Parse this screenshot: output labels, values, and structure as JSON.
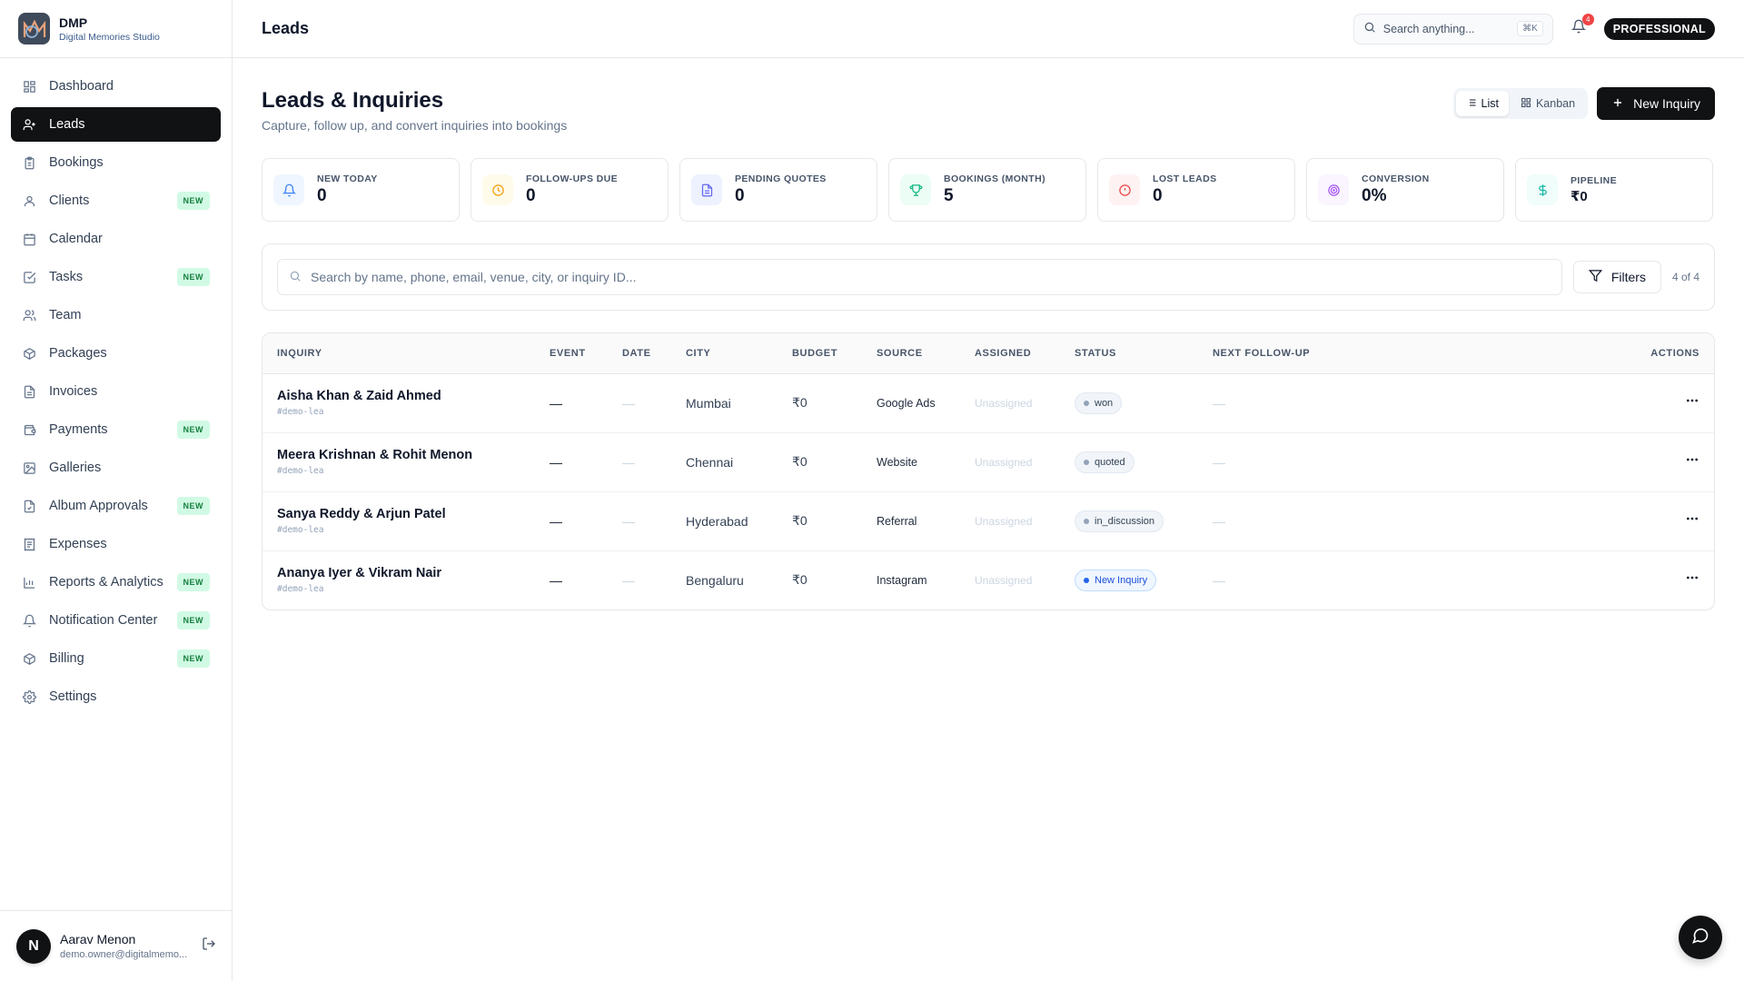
{
  "brand": {
    "name": "DMP",
    "subtitle": "Digital Memories Studio"
  },
  "sidebar": {
    "items": [
      {
        "label": "Dashboard",
        "icon": "dashboard-icon",
        "new": false,
        "active": false
      },
      {
        "label": "Leads",
        "icon": "user-plus-icon",
        "new": false,
        "active": true
      },
      {
        "label": "Bookings",
        "icon": "clipboard-icon",
        "new": false,
        "active": false
      },
      {
        "label": "Clients",
        "icon": "user-icon",
        "new": true,
        "active": false
      },
      {
        "label": "Calendar",
        "icon": "calendar-icon",
        "new": false,
        "active": false
      },
      {
        "label": "Tasks",
        "icon": "checkbox-icon",
        "new": true,
        "active": false
      },
      {
        "label": "Team",
        "icon": "users-icon",
        "new": false,
        "active": false
      },
      {
        "label": "Packages",
        "icon": "package-icon",
        "new": false,
        "active": false
      },
      {
        "label": "Invoices",
        "icon": "file-icon",
        "new": false,
        "active": false
      },
      {
        "label": "Payments",
        "icon": "wallet-icon",
        "new": true,
        "active": false
      },
      {
        "label": "Galleries",
        "icon": "image-icon",
        "new": false,
        "active": false
      },
      {
        "label": "Album Approvals",
        "icon": "file-check-icon",
        "new": true,
        "active": false
      },
      {
        "label": "Expenses",
        "icon": "receipt-icon",
        "new": false,
        "active": false
      },
      {
        "label": "Reports & Analytics",
        "icon": "bar-chart-icon",
        "new": true,
        "active": false
      },
      {
        "label": "Notification Center",
        "icon": "bell-icon",
        "new": true,
        "active": false
      },
      {
        "label": "Billing",
        "icon": "billing-icon",
        "new": true,
        "active": false
      },
      {
        "label": "Settings",
        "icon": "gear-icon",
        "new": false,
        "active": false
      }
    ],
    "new_badge": "NEW"
  },
  "user": {
    "initial": "N",
    "name": "Aarav Menon",
    "email": "demo.owner@digitalmemo..."
  },
  "topbar": {
    "title": "Leads",
    "search_placeholder": "Search anything...",
    "shortcut": "⌘K",
    "notification_count": "4",
    "plan": "PROFESSIONAL"
  },
  "page": {
    "title": "Leads & Inquiries",
    "subtitle": "Capture, follow up, and convert inquiries into bookings",
    "view_list": "List",
    "view_kanban": "Kanban",
    "new_button": "New Inquiry"
  },
  "stats": [
    {
      "label": "NEW TODAY",
      "value": "0",
      "icon": "bell-icon",
      "bg": "#eff6ff",
      "color": "#3b82f6"
    },
    {
      "label": "FOLLOW-UPS DUE",
      "value": "0",
      "icon": "clock-icon",
      "bg": "#fffbeb",
      "color": "#f59e0b"
    },
    {
      "label": "PENDING QUOTES",
      "value": "0",
      "icon": "document-icon",
      "bg": "#eef2ff",
      "color": "#6366f1"
    },
    {
      "label": "BOOKINGS (MONTH)",
      "value": "5",
      "icon": "trophy-icon",
      "bg": "#ecfdf5",
      "color": "#10b981"
    },
    {
      "label": "LOST LEADS",
      "value": "0",
      "icon": "alert-icon",
      "bg": "#fef2f2",
      "color": "#ef4444"
    },
    {
      "label": "CONVERSION",
      "value": "0%",
      "icon": "target-icon",
      "bg": "#faf5ff",
      "color": "#a855f7"
    },
    {
      "label": "PIPELINE",
      "value": "₹0",
      "icon": "dollar-icon",
      "bg": "#f0fdfa",
      "color": "#14b8a6"
    }
  ],
  "search": {
    "placeholder": "Search by name, phone, email, venue, city, or inquiry ID...",
    "filters_label": "Filters",
    "count": "4 of 4"
  },
  "table": {
    "headers": [
      "INQUIRY",
      "EVENT",
      "DATE",
      "CITY",
      "BUDGET",
      "SOURCE",
      "ASSIGNED",
      "STATUS",
      "NEXT FOLLOW-UP",
      "ACTIONS"
    ],
    "rows": [
      {
        "name": "Aisha Khan & Zaid Ahmed",
        "id": "#demo-lea",
        "event": "—",
        "date": "—",
        "city": "Mumbai",
        "budget": "₹0",
        "source": "Google Ads",
        "assigned": "Unassigned",
        "status": "won",
        "status_style": "gray",
        "next": "—"
      },
      {
        "name": "Meera Krishnan & Rohit Menon",
        "id": "#demo-lea",
        "event": "—",
        "date": "—",
        "city": "Chennai",
        "budget": "₹0",
        "source": "Website",
        "assigned": "Unassigned",
        "status": "quoted",
        "status_style": "gray",
        "next": "—"
      },
      {
        "name": "Sanya Reddy & Arjun Patel",
        "id": "#demo-lea",
        "event": "—",
        "date": "—",
        "city": "Hyderabad",
        "budget": "₹0",
        "source": "Referral",
        "assigned": "Unassigned",
        "status": "in_discussion",
        "status_style": "gray",
        "next": "—"
      },
      {
        "name": "Ananya Iyer & Vikram Nair",
        "id": "#demo-lea",
        "event": "—",
        "date": "—",
        "city": "Bengaluru",
        "budget": "₹0",
        "source": "Instagram",
        "assigned": "Unassigned",
        "status": "New Inquiry",
        "status_style": "blue",
        "next": "—"
      }
    ]
  }
}
